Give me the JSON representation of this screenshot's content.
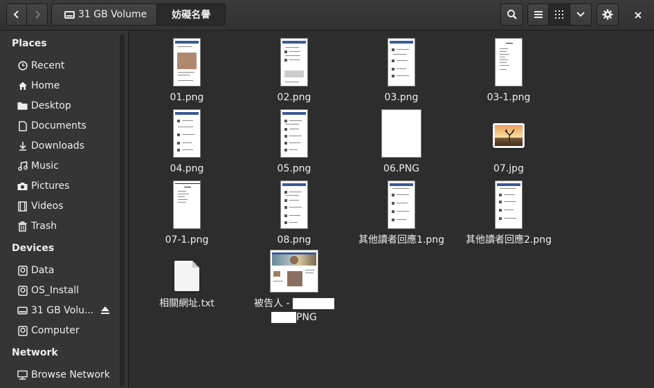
{
  "header": {
    "back_icon": "chevron-left-icon",
    "forward_icon": "chevron-right-icon",
    "breadcrumbs": [
      "31 GB Volume",
      "妨礙名譽"
    ],
    "search_icon": "search-icon",
    "list_icon": "list-view-icon",
    "grid_icon": "grid-view-icon",
    "menu_icon": "chevron-down-icon",
    "settings_icon": "gear-icon",
    "close_icon": "close-icon"
  },
  "sidebar": {
    "places_heading": "Places",
    "places": [
      {
        "label": "Recent",
        "icon": "clock-icon"
      },
      {
        "label": "Home",
        "icon": "home-icon"
      },
      {
        "label": "Desktop",
        "icon": "folder-icon"
      },
      {
        "label": "Documents",
        "icon": "document-icon"
      },
      {
        "label": "Downloads",
        "icon": "download-icon"
      },
      {
        "label": "Music",
        "icon": "music-icon"
      },
      {
        "label": "Pictures",
        "icon": "camera-icon"
      },
      {
        "label": "Videos",
        "icon": "film-icon"
      },
      {
        "label": "Trash",
        "icon": "trash-icon"
      }
    ],
    "devices_heading": "Devices",
    "devices": [
      {
        "label": "Data",
        "icon": "drive-icon"
      },
      {
        "label": "OS_Install",
        "icon": "drive-icon"
      },
      {
        "label": "31 GB Volu...",
        "icon": "drive-icon"
      },
      {
        "label": "Computer",
        "icon": "computer-icon"
      }
    ],
    "network_heading": "Network",
    "network": [
      {
        "label": "Browse Network",
        "icon": "network-icon"
      }
    ]
  },
  "files": [
    {
      "name": "01.png"
    },
    {
      "name": "02.png"
    },
    {
      "name": "03.png"
    },
    {
      "name": "03-1.png"
    },
    {
      "name": "04.png"
    },
    {
      "name": "05.png"
    },
    {
      "name": "06.PNG"
    },
    {
      "name": "07.jpg"
    },
    {
      "name": "07-1.png"
    },
    {
      "name": "08.png"
    },
    {
      "name": "其他讀者回應1.png"
    },
    {
      "name": "其他讀者回應2.png"
    },
    {
      "name": "相關網址.txt"
    },
    {
      "name_prefix": "被告人 -",
      "name_suffix": "PNG"
    }
  ]
}
